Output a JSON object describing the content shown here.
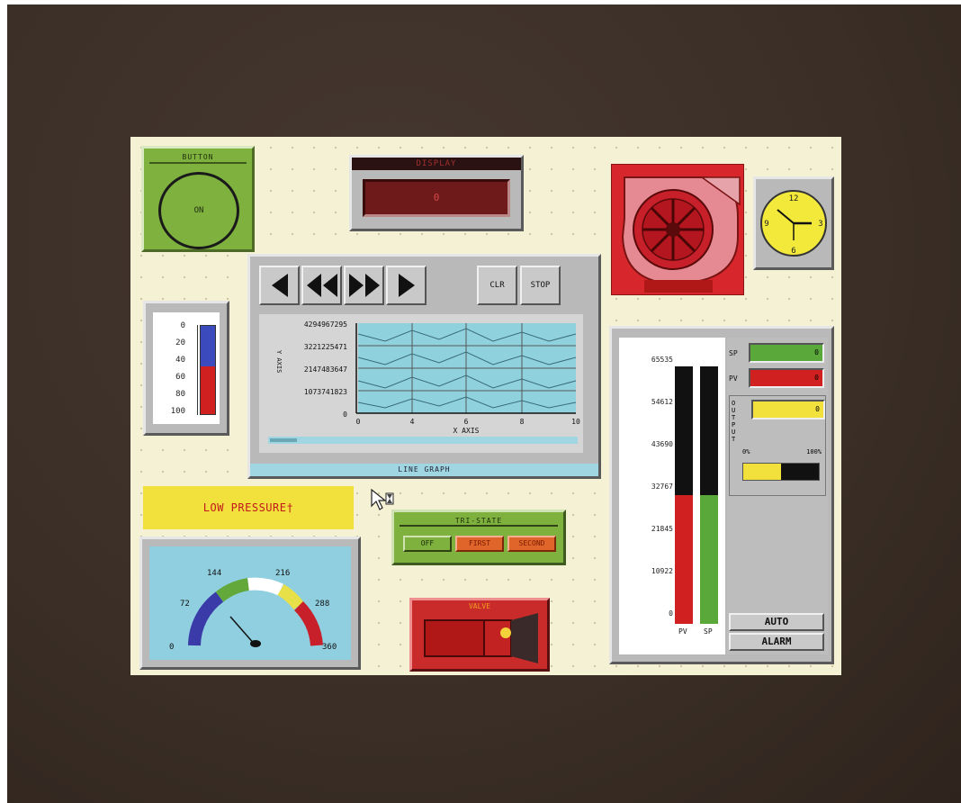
{
  "button_widget": {
    "title": "BUTTON",
    "state_label": "ON"
  },
  "display_widget": {
    "title": "DISPLAY",
    "value": "0"
  },
  "thermometer": {
    "scale": [
      "0",
      "20",
      "40",
      "60",
      "80",
      "100"
    ],
    "value": 54
  },
  "line_graph": {
    "buttons": [
      "◀",
      "◀◀",
      "▶▶",
      "▶",
      "CLR",
      "STOP"
    ],
    "y_ticks": [
      "4294967295",
      "3221225471",
      "2147483647",
      "1073741823",
      "0"
    ],
    "y_axis_label": "Y AXIS",
    "x_ticks": [
      "0",
      "4",
      "6",
      "8",
      "10"
    ],
    "x_axis_label": "X AXIS",
    "footer": "LINE GRAPH"
  },
  "alarm_banner": {
    "text": "LOW PRESSURE†"
  },
  "gauge": {
    "ticks": [
      "0",
      "72",
      "144",
      "216",
      "288",
      "360"
    ],
    "value": 90
  },
  "tristate": {
    "title": "TRI-STATE",
    "options": [
      "OFF",
      "FIRST",
      "SECOND"
    ]
  },
  "valve": {
    "title": "VALVE"
  },
  "pid": {
    "scale": [
      "65535",
      "54612",
      "43690",
      "32767",
      "21845",
      "10922",
      "0"
    ],
    "pv_label": "PV",
    "sp_label": "SP",
    "sp_value": "0",
    "pv_value": "0",
    "output_label": "OUTPUT",
    "output_value": "0",
    "bar_min": "0%",
    "bar_max": "100%",
    "pv_fraction": 0.5,
    "sp_fraction": 0.5,
    "output_fraction": 0.5,
    "auto_label": "AUTO",
    "alarm_label": "ALARM"
  },
  "clock": {
    "numbers": [
      "12",
      "3",
      "6",
      "9"
    ]
  },
  "colors": {
    "screen": "#f4f1d4",
    "bezel": "#3b2f27",
    "widget_green": "#7fb13f",
    "alarm_red": "#d8262d",
    "banner_yellow": "#f2e03c"
  }
}
